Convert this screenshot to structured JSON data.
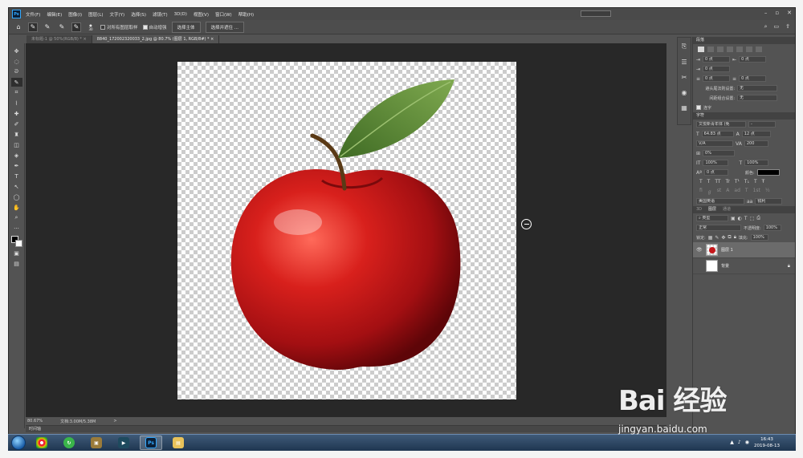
{
  "menubar": {
    "logo": "Ps",
    "items": [
      "文件(F)",
      "编辑(E)",
      "图像(I)",
      "图层(L)",
      "文字(Y)",
      "选择(S)",
      "滤镜(T)",
      "3D(D)",
      "视图(V)",
      "窗口(W)",
      "帮助(H)"
    ],
    "window_controls": [
      "–",
      "▫",
      "✕"
    ]
  },
  "options": {
    "brush_size": "30",
    "sample_all_layers": "对所有图层取样",
    "auto_enhance": "自动增强",
    "select_subject": "选择主体",
    "select_and_mask": "选择并遮住 ..."
  },
  "tabs": [
    {
      "label": "未标题-1 @ 50%(RGB/8) *",
      "close": "×"
    },
    {
      "label": "8840_172002320033_2.jpg @ 80.7% (图层 1, RGB/8#) *",
      "close": "×"
    }
  ],
  "status": {
    "zoom": "80.67%",
    "doc": "文档:3.00M/5.38M",
    "arrow": ">"
  },
  "timeline": {
    "label": "时间轴"
  },
  "paragraph": {
    "title": "段落",
    "indent_left": "0 点",
    "indent_right": "0 点",
    "first_line": "0 点",
    "space_before": "0 点",
    "space_after": "0 点",
    "avoid_label": "避头尾法则设置:",
    "avoid_value": "无",
    "spacing_label": "间距组合设置:",
    "spacing_value": "无",
    "hyphenate": "连字"
  },
  "character": {
    "title": "字符",
    "font": "文悦新青年体 (免",
    "style": "-",
    "size": "64.83 点",
    "leading": "12 点",
    "kerning": "V/A",
    "tracking": "200",
    "scale_pct": "0%",
    "vscale": "100%",
    "hscale": "100%",
    "baseline": "0 点",
    "color_label": "颜色:",
    "glyphs": [
      "T",
      "T",
      "TT",
      "Tr",
      "T¹",
      "T₁",
      "T",
      "Ŧ"
    ],
    "language": "美国英语",
    "antialias": "锐利"
  },
  "layers": {
    "tabs": [
      "3D",
      "图层",
      "通道"
    ],
    "filter": "类型",
    "blend": "正常",
    "opacity_label": "不透明度:",
    "opacity": "100%",
    "lock_label": "锁定:",
    "fill_label": "填充:",
    "fill": "100%",
    "items": [
      {
        "name": "图层 1",
        "visible": "👁"
      },
      {
        "name": "背景",
        "visible": ""
      }
    ]
  },
  "taskbar": {
    "time": "16:43",
    "date": "2019-08-13",
    "ps_label": "Ps"
  },
  "watermark": {
    "line1": "Bai  经验",
    "line2": "jingyan.baidu.com"
  }
}
